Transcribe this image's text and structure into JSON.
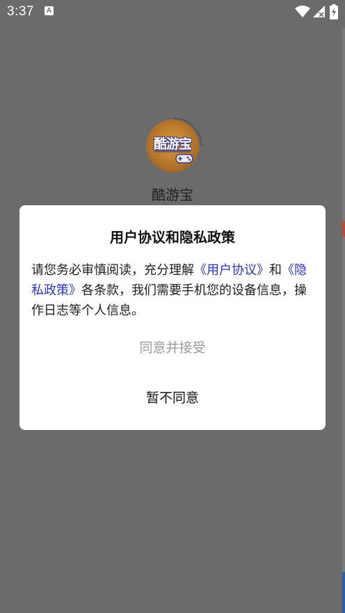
{
  "status_bar": {
    "time": "3:37",
    "notification_icon": "A"
  },
  "app": {
    "name": "酷游宝",
    "logo_text": "酷游宝"
  },
  "dialog": {
    "title": "用户协议和隐私政策",
    "body_prefix": "请您务必审慎阅读，充分理解",
    "user_agreement_link": "《用户协议》",
    "body_and": "和",
    "privacy_policy_link": "《隐私政策》",
    "body_suffix": "各条款，我们需要手机您的设备信息，操作日志等个人信息。",
    "accept_label": "同意并接受",
    "decline_label": "暂不同意"
  },
  "colors": {
    "overlay": "#6b6b6b",
    "link": "#2e35c6",
    "accept_text": "#9a9a9a"
  }
}
